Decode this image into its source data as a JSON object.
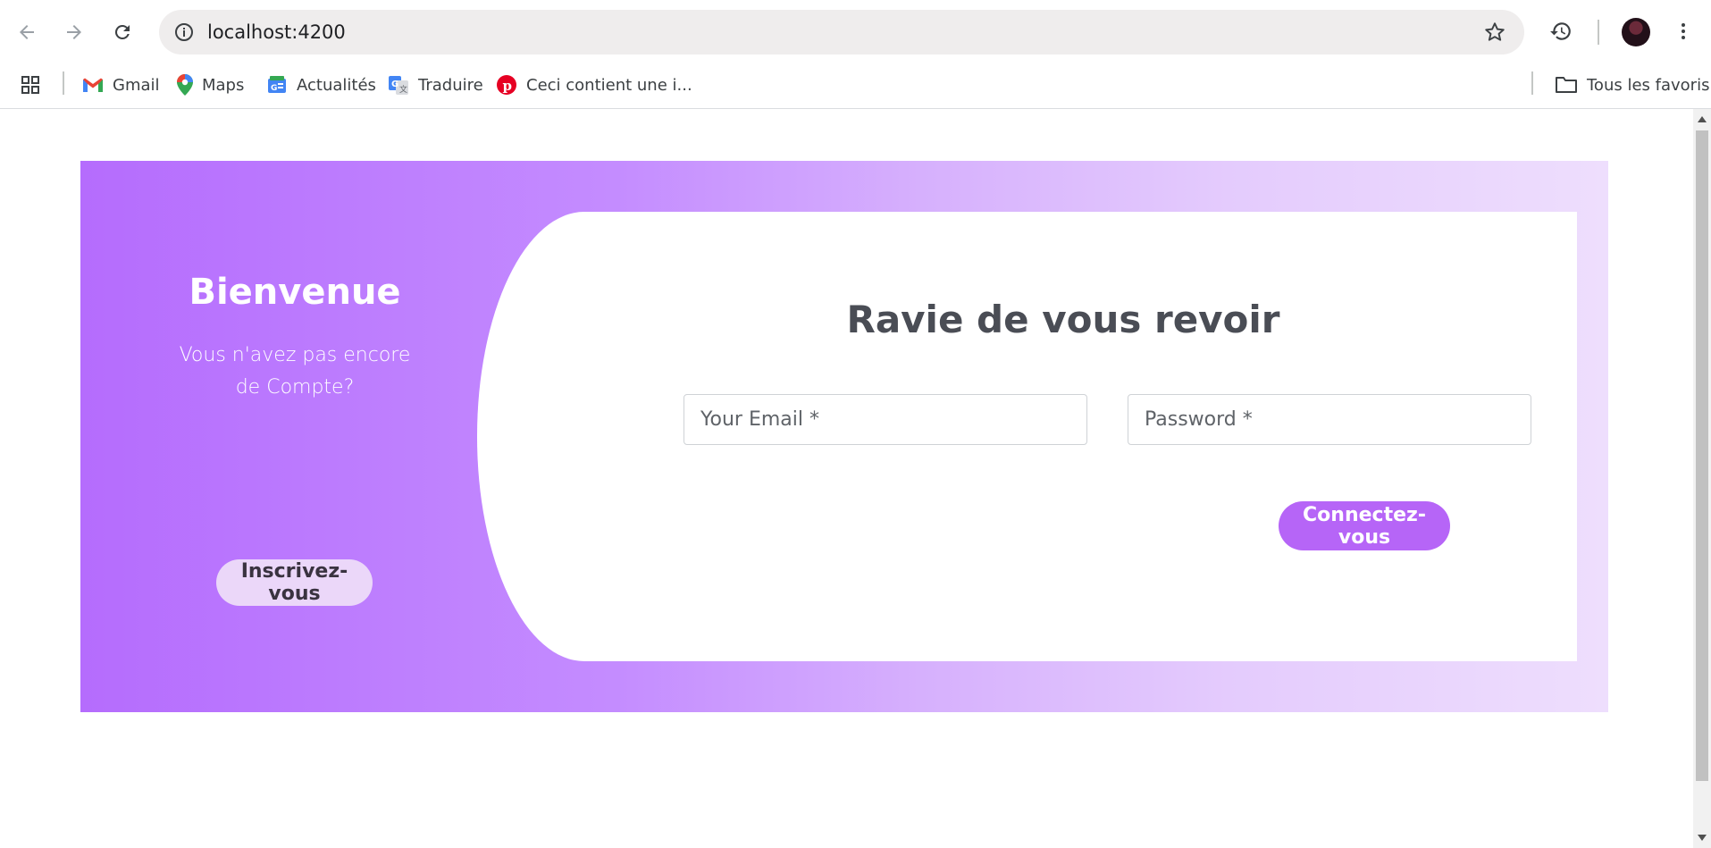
{
  "browser": {
    "url": "localhost:4200",
    "icons": {
      "back": "arrow-left-icon",
      "forward": "arrow-right-icon",
      "reload": "reload-icon",
      "info": "info-icon",
      "star": "star-icon",
      "history": "history-icon",
      "menu": "kebab-menu-icon"
    },
    "bookmarks": [
      {
        "label": "Gmail",
        "icon": "gmail-icon"
      },
      {
        "label": "Maps",
        "icon": "maps-icon"
      },
      {
        "label": "Actualités",
        "icon": "news-icon"
      },
      {
        "label": "Traduire",
        "icon": "translate-icon"
      },
      {
        "label": "Ceci contient une i...",
        "icon": "pinterest-icon"
      }
    ],
    "all_bookmarks": "Tous les favoris"
  },
  "left_panel": {
    "title": "Bienvenue",
    "subtitle": "Vous n'avez pas encore de Compte?",
    "signup_button": "Inscrivez-vous"
  },
  "form": {
    "title": "Ravie de vous revoir",
    "email_placeholder": "Your Email *",
    "password_placeholder": "Password *",
    "login_button": "Connectez-vous"
  },
  "colors": {
    "gradient_start": "#b56cfd",
    "gradient_end": "#eedefd",
    "login_button": "#b665f7",
    "signup_button": "#ebd7f9"
  }
}
